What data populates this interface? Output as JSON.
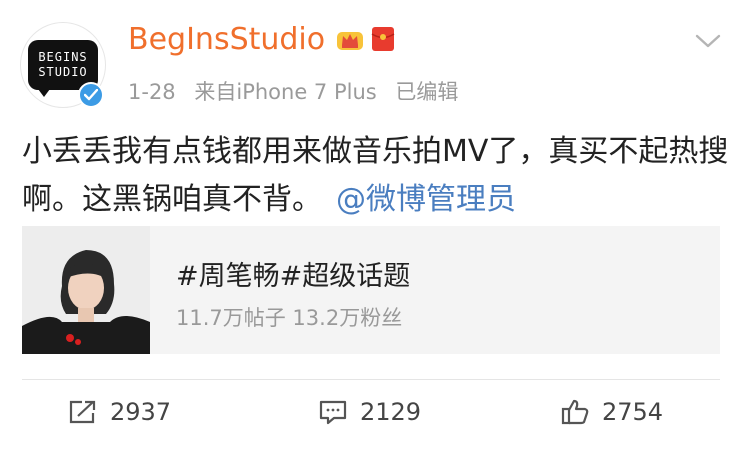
{
  "avatar": {
    "logo_line1": "BEGINS",
    "logo_line2": "STUDIO",
    "badge_color": "#3c9be5"
  },
  "header": {
    "username": "BegInsStudio",
    "username_color": "#f06f2c",
    "icons": [
      "crown-badge-icon",
      "red-envelope-icon",
      "chevron-down-icon"
    ]
  },
  "meta": {
    "date": "1-28",
    "source": "来自iPhone 7 Plus",
    "edited": "已编辑"
  },
  "post": {
    "text": "小丢丢我有点钱都用来做音乐拍MV了，真买不起热搜啊。这黑锅咱真不背。",
    "mention": "@微博管理员",
    "mention_color": "#4a7ec0"
  },
  "topic_card": {
    "title": "#周笔畅#超级话题",
    "stats": "11.7万帖子 13.2万粉丝"
  },
  "actions": {
    "repost_count": "2937",
    "comment_count": "2129",
    "like_count": "2754"
  }
}
